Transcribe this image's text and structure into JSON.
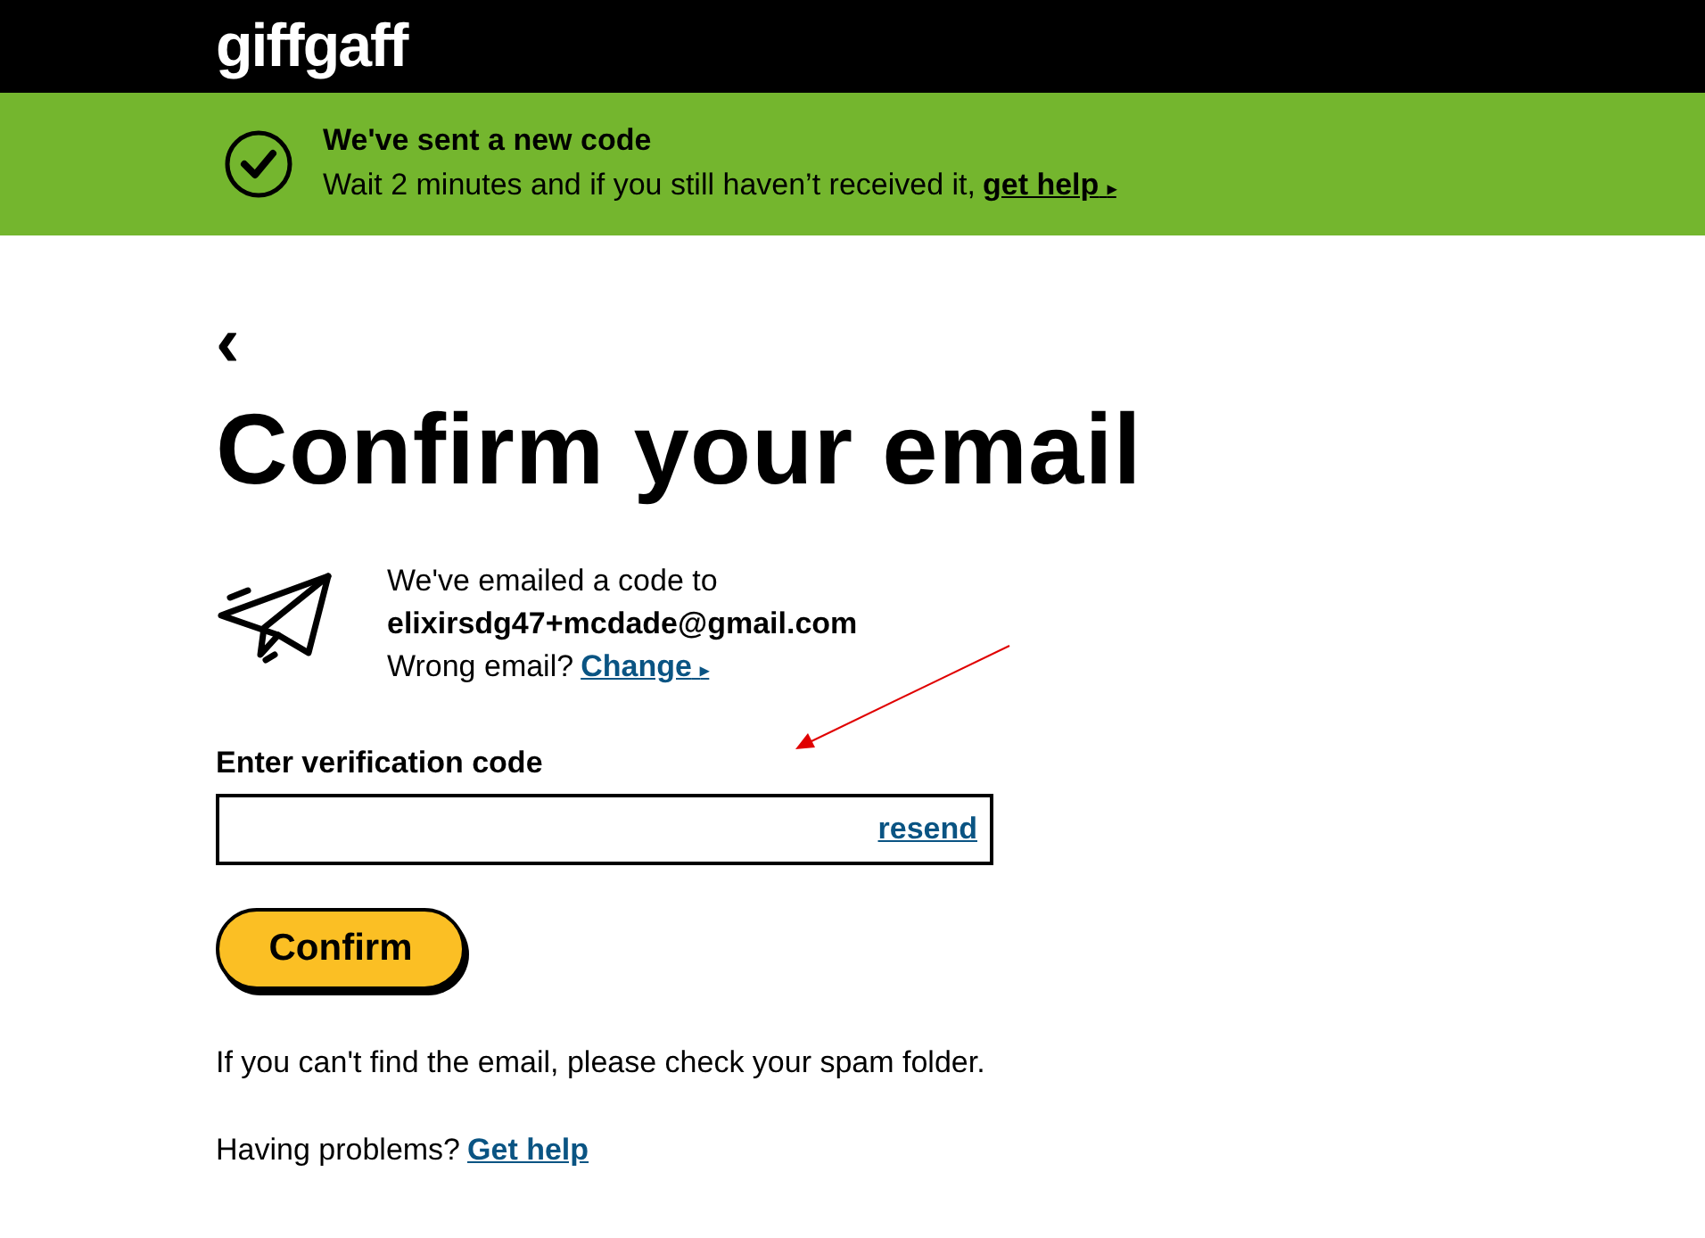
{
  "header": {
    "logo": "giffgaff"
  },
  "banner": {
    "title": "We've sent a new code",
    "message": "Wait 2 minutes and if you still haven’t received it,",
    "link": "get help",
    "link_arrow": "▸"
  },
  "back": "‹",
  "title": "Confirm your email",
  "sent_info": {
    "line": "We've emailed a code to",
    "email": "elixirsdg47+mcdade@gmail.com",
    "wrong": "Wrong email?",
    "change_link": "Change",
    "change_arrow": "▸"
  },
  "code_field": {
    "label": "Enter verification code",
    "resend": "resend"
  },
  "confirm_button": "Confirm",
  "spam_note": "If you can't find the email, please check your spam folder.",
  "help": {
    "text": "Having problems?",
    "link": "Get help"
  }
}
